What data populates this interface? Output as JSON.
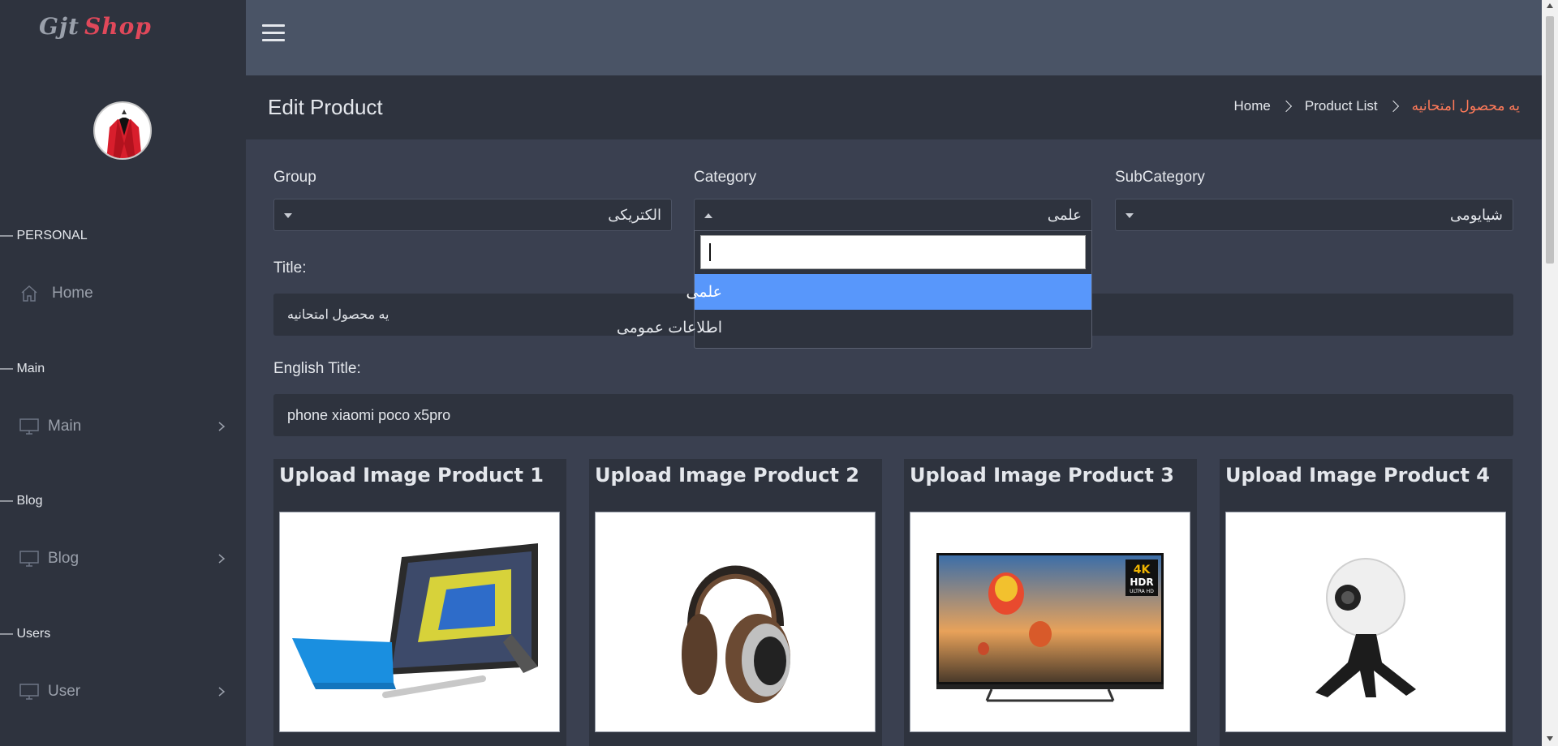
{
  "brand": {
    "part1": "Gjt",
    "part2": "Shop"
  },
  "sidebar": {
    "sections": [
      {
        "heading": "— PERSONAL",
        "item": "Home",
        "icon": "home-icon"
      },
      {
        "heading": "— Main",
        "item": "Main",
        "icon": "monitor-icon"
      },
      {
        "heading": "— Blog",
        "item": "Blog",
        "icon": "monitor-icon"
      },
      {
        "heading": "— Users",
        "item": "User",
        "icon": "monitor-icon"
      }
    ]
  },
  "header": {
    "title": "Edit Product",
    "breadcrumb": [
      "Home",
      "Product List",
      "یه محصول امتحانیه"
    ]
  },
  "form": {
    "group_label": "Group",
    "group_value": "الکتریکی",
    "category_label": "Category",
    "category_value": "علمی",
    "subcategory_label": "SubCategory",
    "subcategory_value": "شیایومی",
    "title_label": "Title:",
    "title_value": "یه محصول امتحانیه",
    "english_title_label": "English Title:",
    "english_title_value": "phone xiaomi poco x5pro"
  },
  "category_dropdown": {
    "options": [
      "علمی",
      "اطلاعات عمومی"
    ],
    "selected_index": 0
  },
  "uploads": [
    {
      "title": "Upload Image Product 1",
      "image": "tablet-with-keyboard-and-pen"
    },
    {
      "title": "Upload Image Product 2",
      "image": "over-ear-headphones"
    },
    {
      "title": "Upload Image Product 3",
      "image": "4k-hdr-television"
    },
    {
      "title": "Upload Image Product 4",
      "image": "360-camera-on-tripod"
    }
  ],
  "tv_badge": {
    "line1": "4K",
    "line2": "HDR",
    "line3": "ULTRA HD"
  },
  "colors": {
    "accent": "#ff7a59",
    "selected": "#5897fb",
    "sidebar": "#2e333e",
    "topbar": "#4a5466"
  }
}
